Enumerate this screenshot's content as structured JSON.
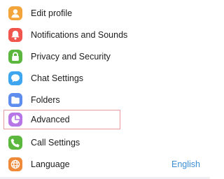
{
  "colors": {
    "highlight_border": "#e89a9f",
    "value_text": "#3b8ed6",
    "label_text": "#1c1c1e"
  },
  "menu": {
    "items": [
      {
        "label": "Edit profile",
        "icon": "person-icon",
        "icon_color": "#f3a43a"
      },
      {
        "label": "Notifications and Sounds",
        "icon": "bell-icon",
        "icon_color": "#f0564e"
      },
      {
        "label": "Privacy and Security",
        "icon": "lock-icon",
        "icon_color": "#5cb73e"
      },
      {
        "label": "Chat Settings",
        "icon": "chat-bubble-icon",
        "icon_color": "#3da6ee"
      },
      {
        "label": "Folders",
        "icon": "folder-icon",
        "icon_color": "#5e8ded"
      },
      {
        "label": "Advanced",
        "icon": "pie-chart-icon",
        "icon_color": "#b776e6",
        "highlighted": true
      },
      {
        "label": "Call Settings",
        "icon": "phone-icon",
        "icon_color": "#5cb73e"
      },
      {
        "label": "Language",
        "icon": "globe-icon",
        "icon_color": "#ee8a3a",
        "value": "English"
      }
    ]
  }
}
